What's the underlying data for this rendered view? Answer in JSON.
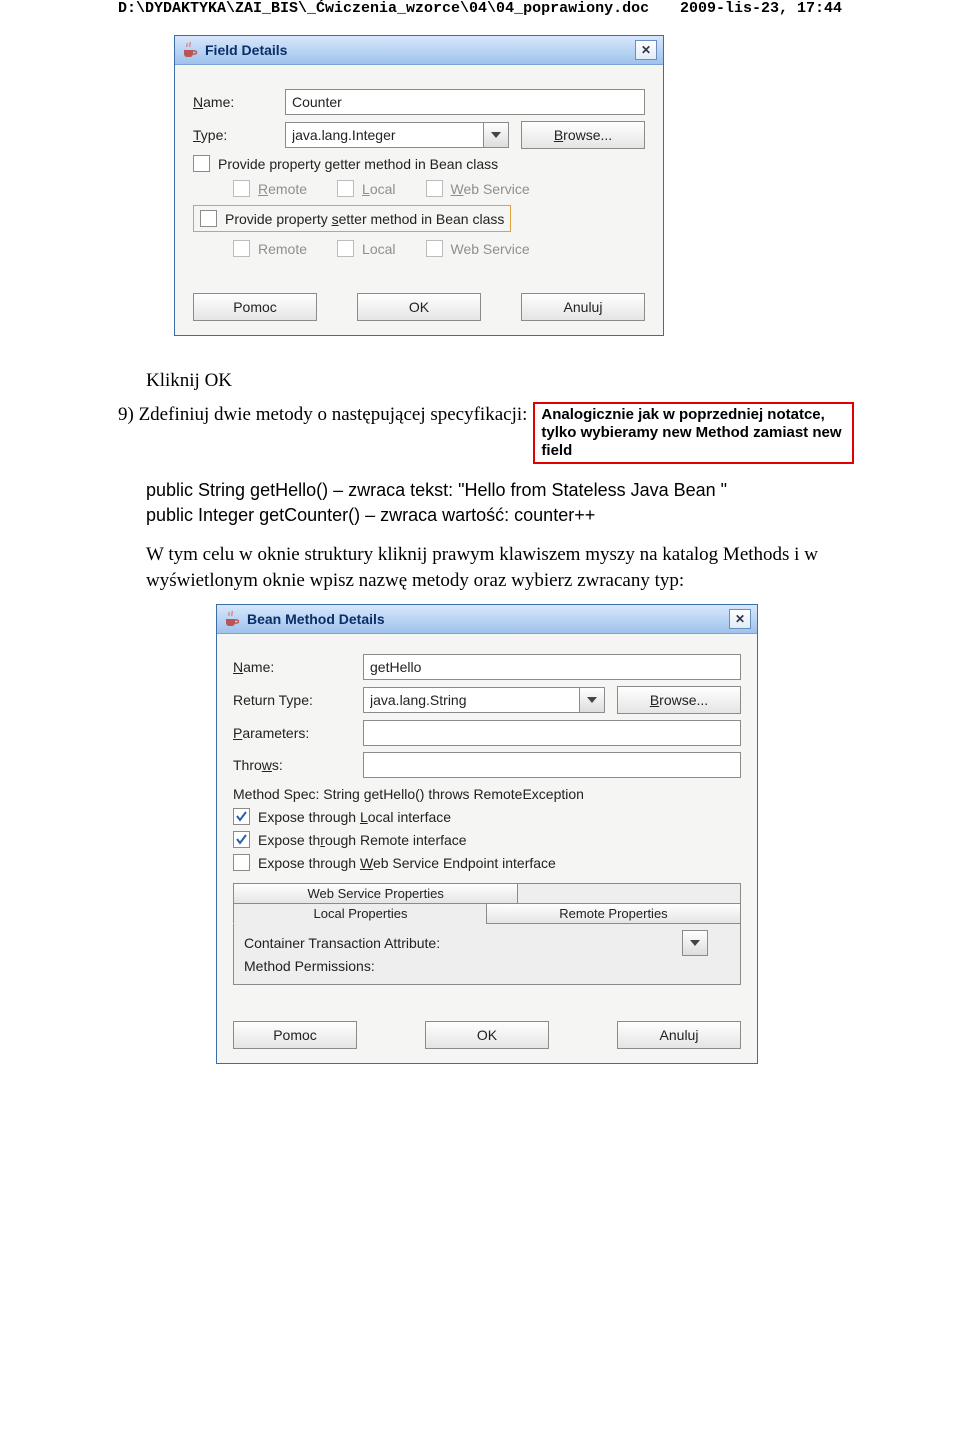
{
  "header": {
    "path": "D:\\DYDAKTYKA\\ZAI_BIS\\_Ćwiczenia_wzorce\\04\\04_poprawiony.doc",
    "date": "2009-lis-23, 17:44"
  },
  "dlg1": {
    "title": "Field Details",
    "name": {
      "label": "Name:",
      "mnemonic": "N",
      "value": "Counter"
    },
    "type": {
      "label": "Type:",
      "mnemonic": "T",
      "value": "java.lang.Integer"
    },
    "browse": "Browse...",
    "browse_mn": "B",
    "getter": "Provide property getter method in Bean class",
    "getter_mn": "g",
    "setter": "Provide property setter method in Bean class",
    "setter_mn": "s",
    "remote": "Remote",
    "remote_mn": "R",
    "local": "Local",
    "local_mn": "L",
    "ws": "Web Service",
    "ws_mn": "W",
    "help": "Pomoc",
    "ok": "OK",
    "cancel": "Anuluj"
  },
  "doc": {
    "kok": "Kliknij OK",
    "l9": "9) Zdefiniuj dwie metody o następującej specyfikacji:",
    "annot": "Analogicznie jak w poprzedniej notatce, tylko wybieramy new Method zamiast new field",
    "m1": "public String getHello() – zwraca tekst: \"Hello from Stateless Java Bean \"",
    "m2": "public Integer getCounter() – zwraca wartość: counter++",
    "para": "W tym celu w oknie struktury kliknij prawym klawiszem myszy na katalog Methods i w wyświetlonym oknie wpisz nazwę metody oraz wybierz zwracany typ:"
  },
  "dlg2": {
    "title": "Bean Method Details",
    "name": {
      "label": "Name:",
      "mnemonic": "N",
      "value": "getHello"
    },
    "rtype": {
      "label": "Return Type:",
      "value": "java.lang.String"
    },
    "params": {
      "label": "Parameters:",
      "mnemonic": "P",
      "value": ""
    },
    "throws": {
      "label": "Throws:",
      "mnemonic": "w",
      "value": ""
    },
    "browse": "Browse...",
    "browse_mn": "B",
    "spec": "Method Spec: String getHello() throws RemoteException",
    "exp_local": "Expose through Local interface",
    "exp_local_mn": "L",
    "exp_remote": "Expose through Remote interface",
    "exp_remote_mn": "R",
    "exp_ws": "Expose through Web Service Endpoint interface",
    "exp_ws_mn": "W",
    "tab_ws": "Web Service Properties",
    "tab_local": "Local Properties",
    "tab_remote": "Remote Properties",
    "cta": "Container Transaction Attribute:",
    "mp": "Method Permissions:",
    "help": "Pomoc",
    "ok": "OK",
    "cancel": "Anuluj"
  }
}
